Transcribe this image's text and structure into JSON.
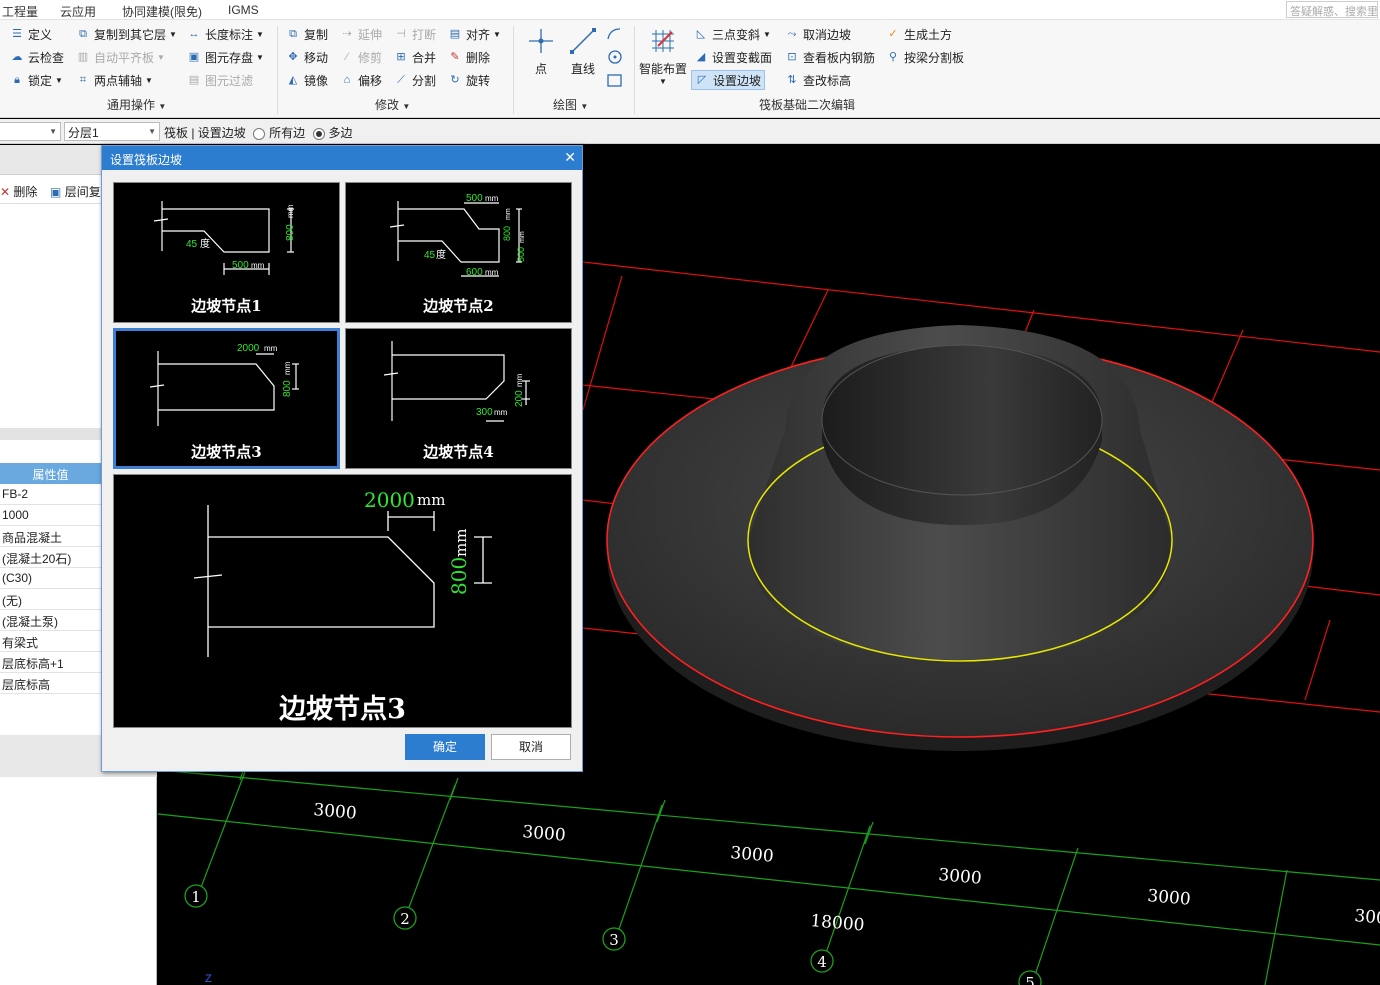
{
  "menu": {
    "items": [
      "工程量",
      "云应用",
      "协同建模(限免)",
      "IGMS"
    ],
    "search_placeholder": "答疑解惑、搜索里"
  },
  "ribbon": {
    "general": {
      "title": "通用操作",
      "items": [
        "定义",
        "复制到其它层",
        "长度标注",
        "云检查",
        "自动平齐板",
        "图元存盘",
        "锁定",
        "两点辅轴",
        "图元过滤"
      ]
    },
    "modify": {
      "title": "修改",
      "items": [
        "复制",
        "延伸",
        "打断",
        "对齐",
        "移动",
        "修剪",
        "合并",
        "删除",
        "镜像",
        "偏移",
        "分割",
        "旋转"
      ]
    },
    "draw": {
      "title": "绘图",
      "items": [
        "点",
        "直线"
      ]
    },
    "raft": {
      "title": "筏板基础二次编辑",
      "items": [
        "智能布置",
        "三点变斜",
        "取消边坡",
        "生成土方",
        "设置变截面",
        "查看板内钢筋",
        "按梁分割板",
        "设置边坡",
        "查改标高"
      ]
    }
  },
  "toolbar2": {
    "combo1": "",
    "combo2": "分层1",
    "context": "筏板 | 设置边坡",
    "radio1": "所有边",
    "radio2": "多边",
    "radio2_selected": true
  },
  "left_panel": {
    "delete": "删除",
    "copy": "层间复",
    "prop_header": "属性值",
    "props": [
      "FB-2",
      "1000",
      "商品混凝土",
      "(混凝土20石)",
      "(C30)",
      "(无)",
      "(混凝土泵)",
      "有梁式",
      "层底标高+1",
      "层底标高"
    ]
  },
  "dialog": {
    "title": "设置筏板边坡",
    "nodes": [
      {
        "label": "边坡节点1",
        "dims": [
          "45",
          "度",
          "800",
          "mm",
          "500",
          "mm"
        ]
      },
      {
        "label": "边坡节点2",
        "dims": [
          "500",
          "mm",
          "800",
          "mm",
          "500",
          "mm",
          "45",
          "度",
          "600",
          "mm"
        ]
      },
      {
        "label": "边坡节点3",
        "dims": [
          "2000",
          "mm",
          "800",
          "mm"
        ]
      },
      {
        "label": "边坡节点4",
        "dims": [
          "200",
          "mm",
          "300",
          "mm"
        ]
      }
    ],
    "selected_index": 2,
    "preview": {
      "label": "边坡节点3",
      "dim_width": "2000",
      "dim_height": "800",
      "unit": "mm"
    },
    "ok": "确定",
    "cancel": "取消"
  },
  "viewport": {
    "spans": [
      "3000",
      "3000",
      "3000",
      "3000",
      "3000",
      "300"
    ],
    "total": "18000",
    "axes": [
      "1",
      "2",
      "3",
      "4",
      "5"
    ],
    "coord_label": "Z"
  }
}
